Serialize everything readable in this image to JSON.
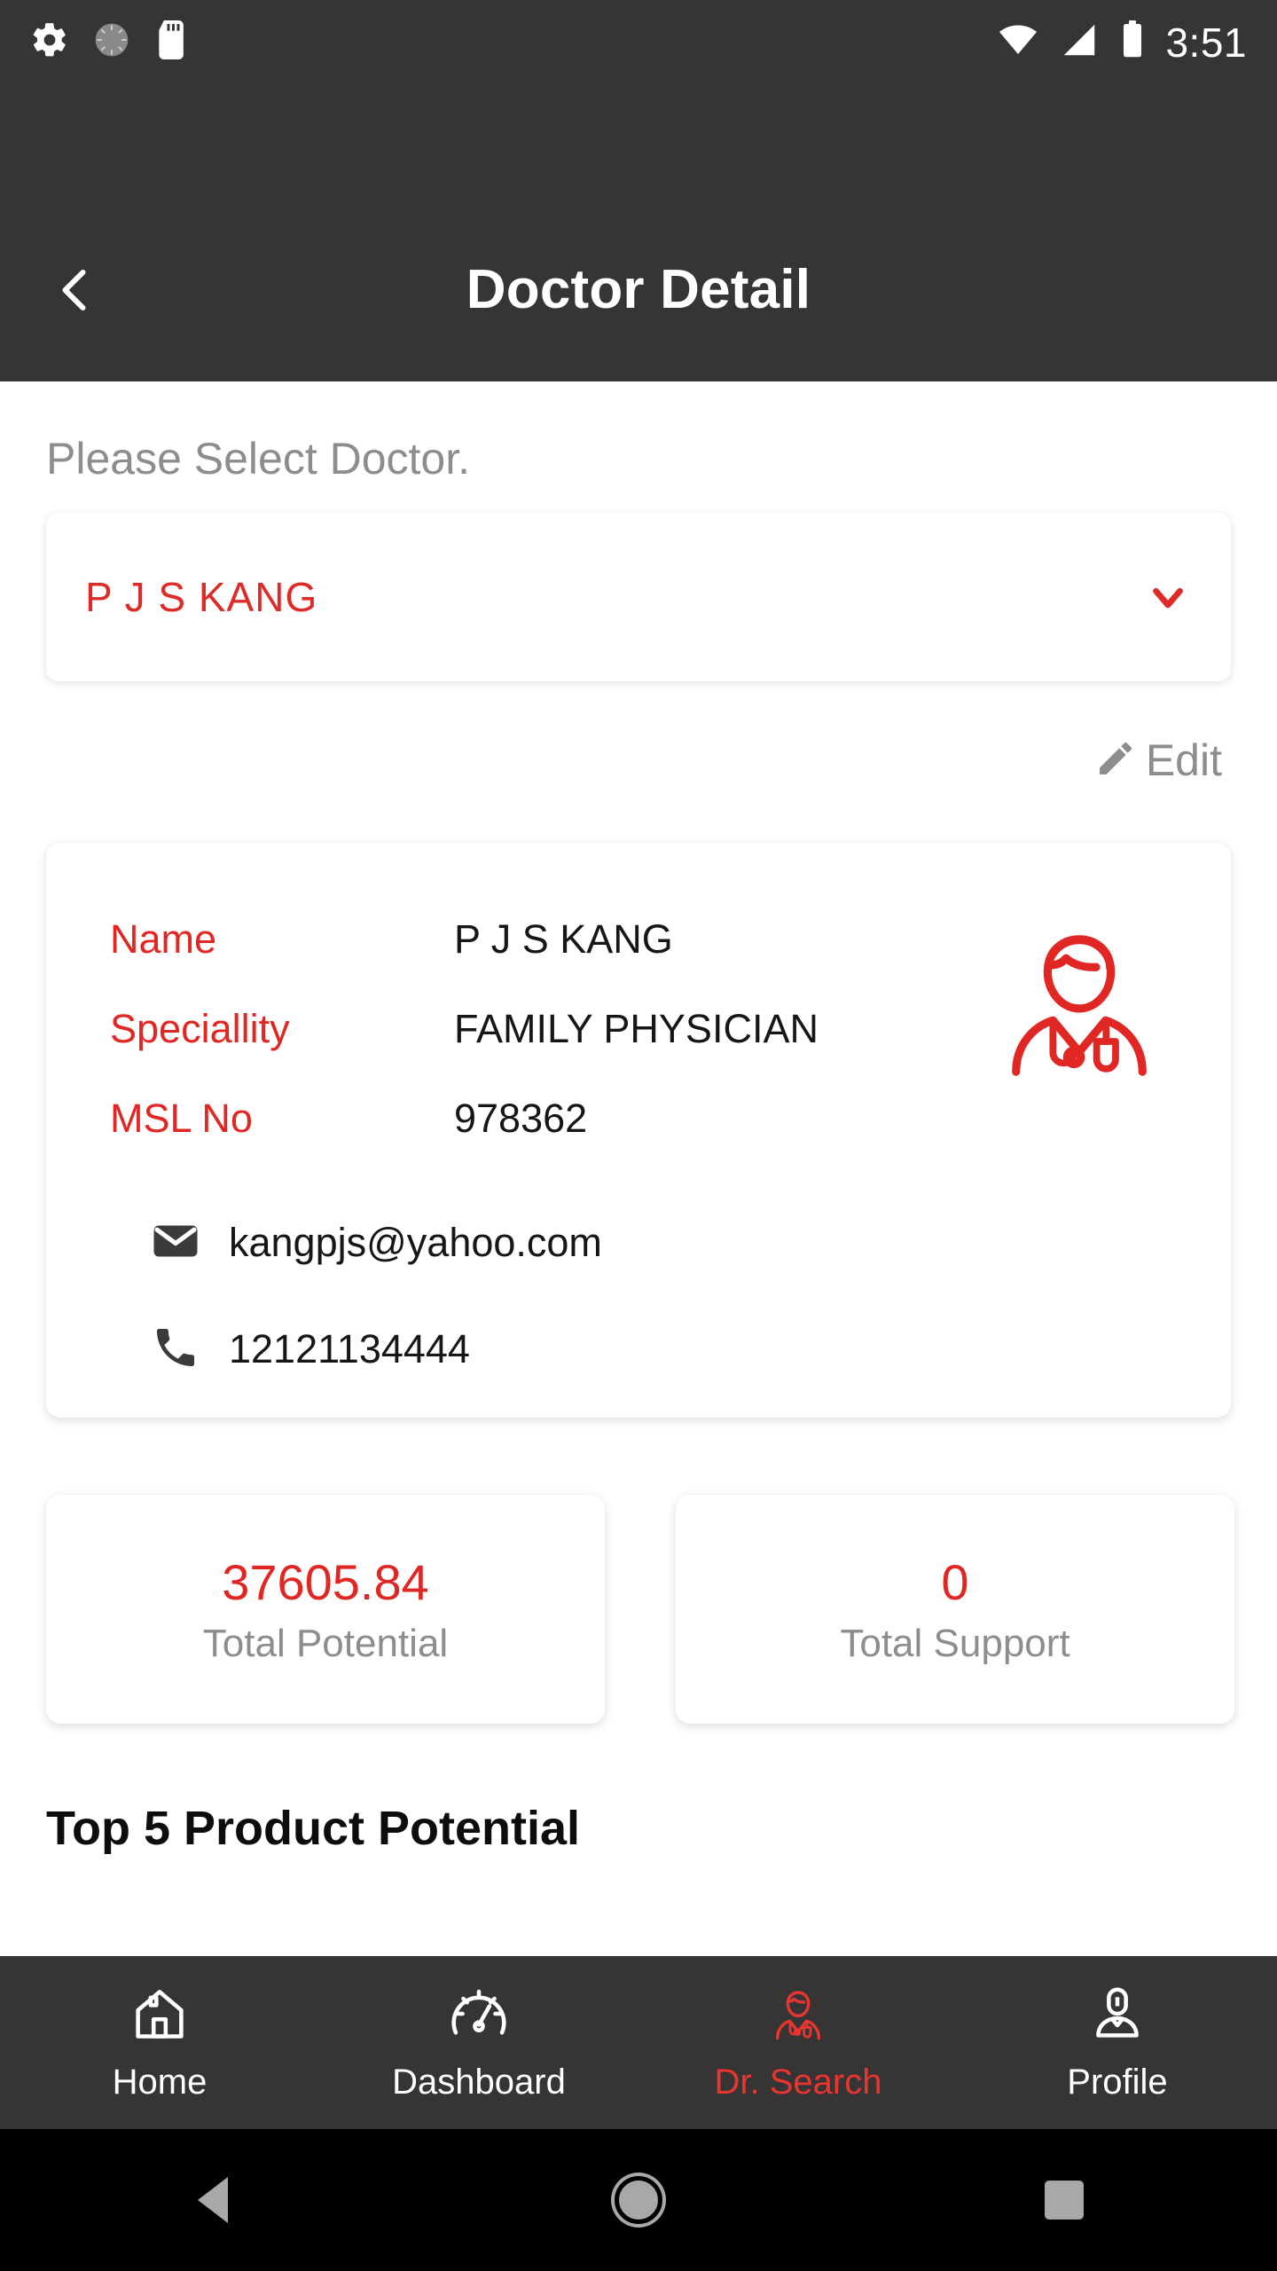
{
  "status_bar": {
    "time": "3:51",
    "left_icons": [
      "settings-gear-icon",
      "sync-progress-icon",
      "sd-card-icon"
    ],
    "right_icons": [
      "wifi-icon",
      "cellular-signal-icon",
      "battery-icon"
    ]
  },
  "app_bar": {
    "title": "Doctor Detail",
    "back_icon": "chevron-left-icon"
  },
  "doctor_select": {
    "label": "Please Select Doctor.",
    "selected_value": "P J S KANG",
    "caret_icon": "chevron-down-icon"
  },
  "edit_action": {
    "label": "Edit",
    "icon": "pencil-icon"
  },
  "info_card": {
    "rows": [
      {
        "key": "Name",
        "value": "P J S KANG"
      },
      {
        "key": "Speciallity",
        "value": "FAMILY PHYSICIAN"
      },
      {
        "key": "MSL No",
        "value": "978362"
      }
    ],
    "email": "kangpjs@yahoo.com",
    "phone": "12121134444",
    "email_icon": "envelope-icon",
    "phone_icon": "phone-icon",
    "avatar_icon": "doctor-avatar-icon"
  },
  "stats": [
    {
      "value": "37605.84",
      "label": "Total Potential"
    },
    {
      "value": "0",
      "label": "Total Support"
    }
  ],
  "section": {
    "title": "Top 5 Product Potential"
  },
  "bottom_nav": {
    "items": [
      {
        "label": "Home",
        "icon": "home-icon",
        "active": false
      },
      {
        "label": "Dashboard",
        "icon": "speedometer-icon",
        "active": false
      },
      {
        "label": "Dr. Search",
        "icon": "doctor-icon",
        "active": true
      },
      {
        "label": "Profile",
        "icon": "person-icon",
        "active": false
      }
    ]
  },
  "android_nav": {
    "back": "back-triangle-icon",
    "home": "home-circle-icon",
    "recents": "recents-square-icon"
  },
  "colors": {
    "accent_red": "#e02724",
    "header_dark": "#363434",
    "muted_gray": "#8d8d8d",
    "page_background": "#ffffff"
  }
}
